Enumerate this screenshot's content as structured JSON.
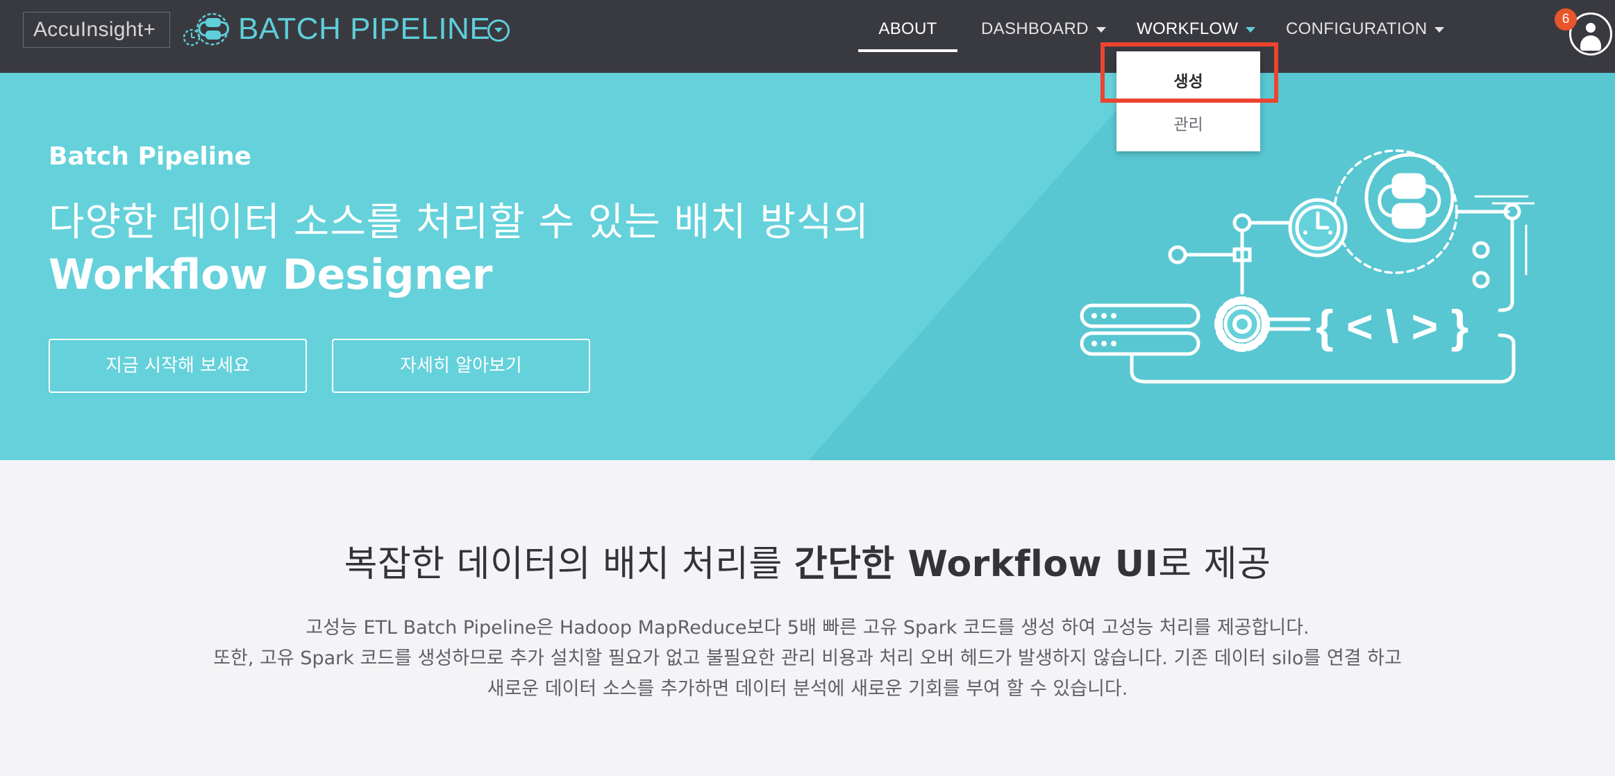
{
  "header": {
    "brand": "AccuInsight+",
    "app_title": "BATCH PIPELINE",
    "nav": {
      "about": "ABOUT",
      "dashboard": "DASHBOARD",
      "workflow": "WORKFLOW",
      "configuration": "CONFIGURATION"
    },
    "notification_count": "6",
    "colors": {
      "bar": "#393a40",
      "accent": "#5ecfdb",
      "badge": "#e8552c"
    }
  },
  "workflow_dropdown": {
    "items": [
      {
        "label": "생성",
        "highlighted": true
      },
      {
        "label": "관리",
        "highlighted": false
      }
    ],
    "highlight_color": "#ec4430"
  },
  "hero": {
    "eyebrow": "Batch Pipeline",
    "headline": "다양한 데이터 소스를 처리할 수 있는 배치 방식의",
    "title": "Workflow Designer",
    "buttons": {
      "start": "지금 시작해 보세요",
      "learn_more": "자세히 알아보기"
    },
    "background": "#65d1db"
  },
  "intro": {
    "title_prefix": "복잡한 데이터의 배치 처리를 ",
    "title_bold": "간단한 Workflow UI",
    "title_suffix": "로 제공",
    "paragraph": [
      "고성능 ETL Batch Pipeline은 Hadoop MapReduce보다 5배 빠른 고유 Spark 코드를 생성 하여 고성능 처리를 제공합니다.",
      "또한, 고유 Spark 코드를 생성하므로 추가 설치할 필요가 없고 불필요한 관리 비용과 처리 오버 헤드가 발생하지 않습니다. 기존 데이터 silo를 연결 하고",
      "새로운 데이터 소스를 추가하면 데이터 분석에 새로운 기회를 부여 할 수 있습니다."
    ]
  }
}
